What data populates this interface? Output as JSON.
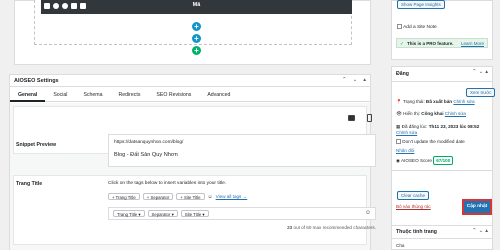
{
  "editor": {
    "block_label": "Mã",
    "toolbar_icons": [
      "pencil-icon",
      "settings-icon",
      "reuse-icon",
      "stack-icon",
      "trash-icon"
    ]
  },
  "aioseo": {
    "title": "AIOSEO Settings",
    "tabs": [
      "General",
      "Social",
      "Schema",
      "Redirects",
      "SEO Revisions",
      "Advanced"
    ],
    "active_tab": "General",
    "snippet_label": "Snippet Preview",
    "snippet_url": "https://datsanquynhon.com/blog/",
    "snippet_title": "Blog - Đất Sản Quy Nhơn",
    "page_title_label": "Trang Title",
    "helper_text": "Click on the tags below to insert variables into your title.",
    "tags": [
      "+ Trang Title",
      "+ Separator",
      "+ Site Title"
    ],
    "view_all": "View all tags →",
    "input_tags": [
      "Trang Title",
      "Separator",
      "Site Title"
    ],
    "count_strong": "23",
    "count_rest": "out of 60 max recommended characters."
  },
  "sidebar": {
    "show_insights": "Show Page Insights",
    "add_note": "Add a Site Note",
    "pro_text": "This is a PRO feature.",
    "pro_learn": "Learn More",
    "dang_title": "Đăng",
    "preview_btn": "Xem trước",
    "status_label": "Trạng thái:",
    "status_value": "Đã xuất bản",
    "status_edit": "Chỉnh sửa",
    "visibility_label": "Hiển thị:",
    "visibility_value": "Công khai",
    "visibility_edit": "Chỉnh sửa",
    "date_label": "Đã đăng lúc:",
    "date_value": "Th11 23, 2023 lúc 08:52",
    "date_edit": "Chỉnh sửa",
    "dont_update": "Don't update the modified date",
    "duplicate": "Nhân đôi",
    "score_label": "AIOSEO Score",
    "score_value": "67/100",
    "clear_cache": "Clear cache",
    "trash_link": "Bỏ vào thùng rác",
    "publish": "Cập nhật",
    "attributes_title": "Thuộc tính trang",
    "parent": "Cha"
  },
  "colors": {
    "accent": "#2271b1",
    "plus_blue": "#0f95c9",
    "plus_green": "#00b16a",
    "highlight": "#d63638",
    "score": "#00aa63"
  }
}
